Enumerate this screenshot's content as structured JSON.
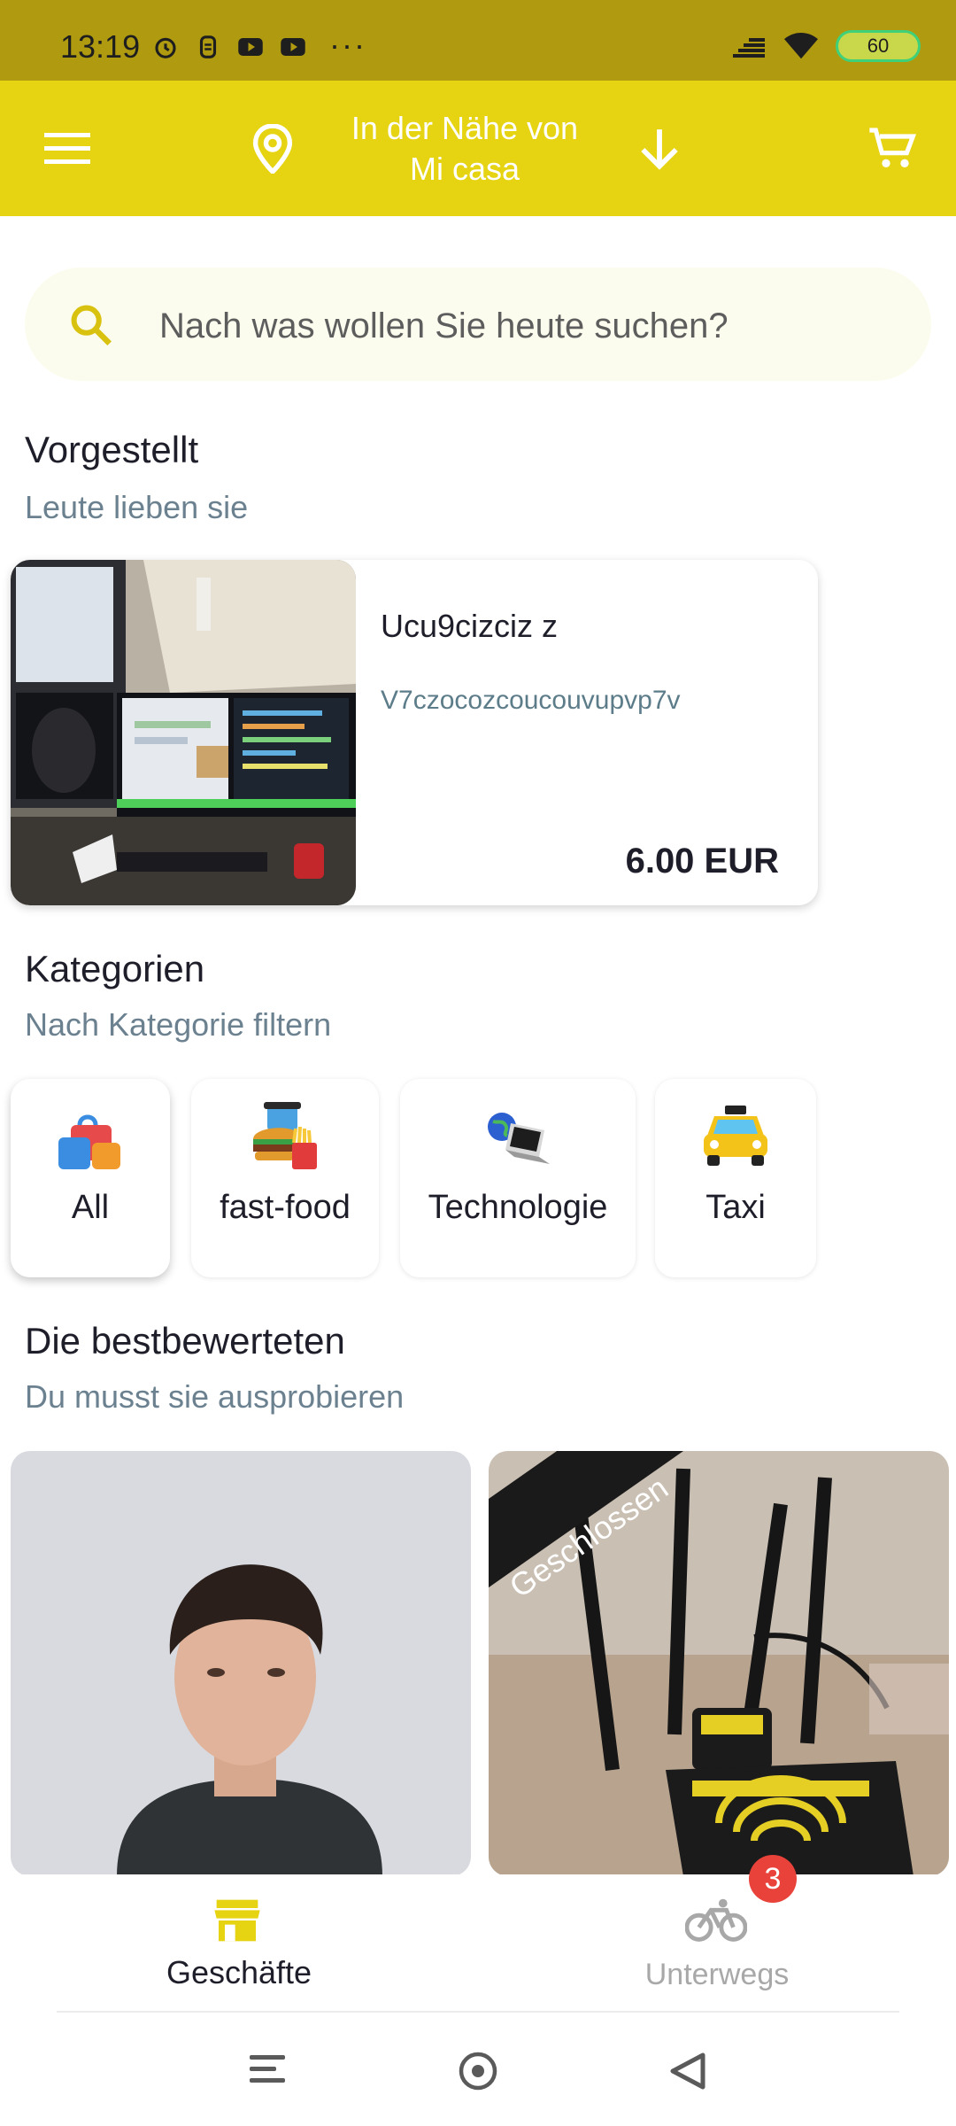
{
  "status": {
    "time": "13:19",
    "dots": "···",
    "battery": "60"
  },
  "header": {
    "location_line1": "In der Nähe von",
    "location_line2": "Mi casa"
  },
  "search": {
    "placeholder": "Nach was wollen Sie heute suchen?"
  },
  "featured": {
    "title": "Vorgestellt",
    "subtitle": "Leute lieben sie",
    "item": {
      "name": "Ucu9cizciz z",
      "description": "V7czocozcoucouvupvp7v",
      "price": "6.00 EUR"
    }
  },
  "categories": {
    "title": "Kategorien",
    "subtitle": "Nach Kategorie filtern",
    "items": [
      {
        "label": "All",
        "icon": "shopping-bags-icon",
        "selected": true
      },
      {
        "label": "fast-food",
        "icon": "burger-drink-icon",
        "selected": false
      },
      {
        "label": "Technologie",
        "icon": "laptop-globe-icon",
        "selected": false
      },
      {
        "label": "Taxi",
        "icon": "taxi-icon",
        "selected": false
      }
    ]
  },
  "top_rated": {
    "title": "Die bestbewerteten",
    "subtitle": "Du musst sie ausprobieren",
    "closed_label": "Geschlossen"
  },
  "bottom_nav": {
    "shops_label": "Geschäfte",
    "onway_label": "Unterwegs",
    "onway_badge": "3"
  },
  "colors": {
    "primary": "#e6d311",
    "status_bar": "#b09b10"
  }
}
